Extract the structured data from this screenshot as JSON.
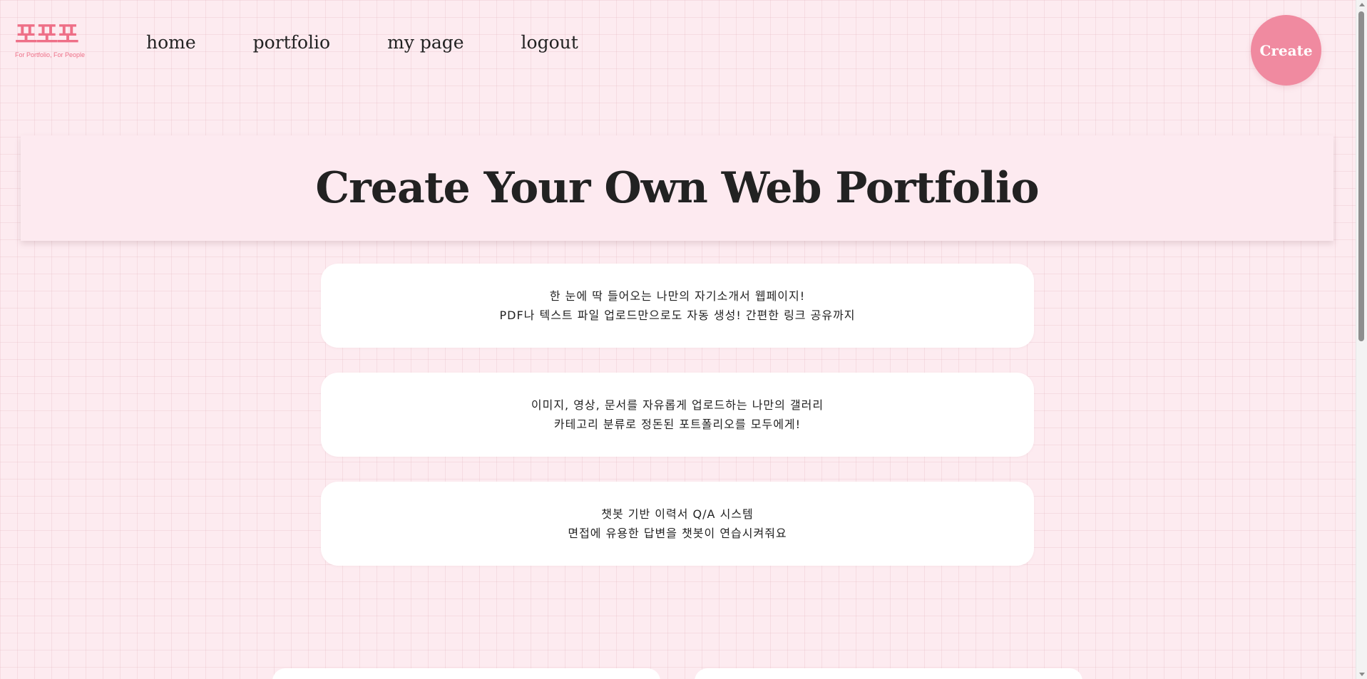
{
  "brand": {
    "logo_text": "포포포",
    "tagline": "For Portfolio, For People",
    "accent_color": "#ee6f87"
  },
  "nav": {
    "items": [
      {
        "label": "home"
      },
      {
        "label": "portfolio"
      },
      {
        "label": "my page"
      },
      {
        "label": "logout"
      }
    ]
  },
  "create_button": {
    "label": "Create",
    "color": "#f08aa0"
  },
  "hero": {
    "title": "Create Your Own Web Portfolio"
  },
  "features": [
    {
      "line1": "한 눈에 딱 들어오는 나만의 자기소개서 웹페이지!",
      "line2": "PDF나 텍스트 파일 업로드만으로도 자동 생성! 간편한 링크 공유까지"
    },
    {
      "line1": "이미지, 영상, 문서를 자유롭게 업로드하는 나만의 갤러리",
      "line2": "카테고리 분류로 정돈된 포트폴리오를 모두에게!"
    },
    {
      "line1": "챗봇 기반 이력서 Q/A 시스템",
      "line2": "면접에 유용한 답변을 챗봇이 연습시켜줘요"
    }
  ],
  "theme": {
    "background": "#fdebf0",
    "card_background": "#ffffff"
  }
}
